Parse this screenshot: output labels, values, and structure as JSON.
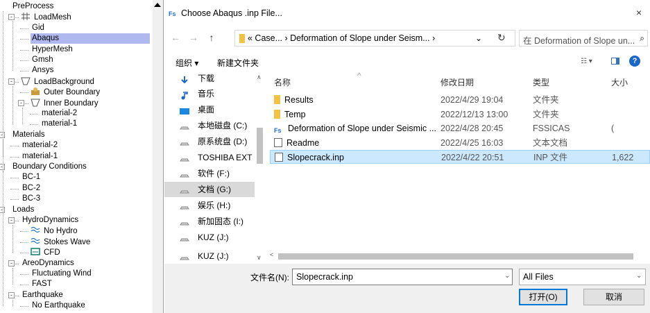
{
  "tree": {
    "nodes": [
      {
        "label": "PreProcess",
        "level": 0,
        "exp": "",
        "icon": ""
      },
      {
        "label": "LoadMesh",
        "level": 1,
        "exp": "-",
        "icon": "mesh"
      },
      {
        "label": "Gid",
        "level": 2,
        "exp": "",
        "icon": ""
      },
      {
        "label": "Abaqus",
        "level": 2,
        "exp": "",
        "icon": "",
        "selected": true
      },
      {
        "label": "HyperMesh",
        "level": 2,
        "exp": "",
        "icon": ""
      },
      {
        "label": "Gmsh",
        "level": 2,
        "exp": "",
        "icon": ""
      },
      {
        "label": "Ansys",
        "level": 2,
        "exp": "",
        "icon": ""
      },
      {
        "label": "LoadBackground",
        "level": 1,
        "exp": "-",
        "icon": "trapezoid"
      },
      {
        "label": "Outer Boundary",
        "level": 2,
        "exp": "",
        "icon": "outer"
      },
      {
        "label": "Inner Boundary",
        "level": 2,
        "exp": "-",
        "icon": "trapezoid"
      },
      {
        "label": "material-2",
        "level": 3,
        "exp": "",
        "icon": ""
      },
      {
        "label": "material-1",
        "level": 3,
        "exp": "",
        "icon": ""
      },
      {
        "label": "Materials",
        "level": 0,
        "exp": "-",
        "icon": ""
      },
      {
        "label": "material-2",
        "level": 1,
        "exp": "",
        "icon": ""
      },
      {
        "label": "material-1",
        "level": 1,
        "exp": "",
        "icon": ""
      },
      {
        "label": "Boundary Conditions",
        "level": 0,
        "exp": "-",
        "icon": ""
      },
      {
        "label": "BC-1",
        "level": 1,
        "exp": "",
        "icon": ""
      },
      {
        "label": "BC-2",
        "level": 1,
        "exp": "",
        "icon": ""
      },
      {
        "label": "BC-3",
        "level": 1,
        "exp": "",
        "icon": ""
      },
      {
        "label": "Loads",
        "level": 0,
        "exp": "-",
        "icon": ""
      },
      {
        "label": "HydroDynamics",
        "level": 1,
        "exp": "-",
        "icon": ""
      },
      {
        "label": "No Hydro",
        "level": 2,
        "exp": "",
        "icon": "wave"
      },
      {
        "label": "Stokes Wave",
        "level": 2,
        "exp": "",
        "icon": "wave"
      },
      {
        "label": "CFD",
        "level": 2,
        "exp": "",
        "icon": "cfd"
      },
      {
        "label": "AreoDynamics",
        "level": 1,
        "exp": "-",
        "icon": ""
      },
      {
        "label": "Fluctuating Wind",
        "level": 2,
        "exp": "",
        "icon": ""
      },
      {
        "label": "FAST",
        "level": 2,
        "exp": "",
        "icon": ""
      },
      {
        "label": "Earthquake",
        "level": 1,
        "exp": "-",
        "icon": ""
      },
      {
        "label": "No Earthquake",
        "level": 2,
        "exp": "",
        "icon": ""
      }
    ]
  },
  "dialog": {
    "title": "Choose Abaqus .inp File...",
    "close": "×",
    "address": "« Case...  ›  Deformation of Slope under Seism...  ›",
    "search_placeholder": "在 Deformation of Slope un...",
    "toolbar": {
      "organize": "组织 ▾",
      "new_folder": "新建文件夹"
    },
    "nav_items": [
      {
        "label": "下载",
        "icon": "download"
      },
      {
        "label": "音乐",
        "icon": "music"
      },
      {
        "label": "桌面",
        "icon": "desktop"
      },
      {
        "label": "本地磁盘 (C:)",
        "icon": "drive"
      },
      {
        "label": "原系统盘 (D:)",
        "icon": "drive"
      },
      {
        "label": "TOSHIBA EXT (I",
        "icon": "drive"
      },
      {
        "label": "软件 (F:)",
        "icon": "drive"
      },
      {
        "label": "文档 (G:)",
        "icon": "drive",
        "selected": true
      },
      {
        "label": "娱乐 (H:)",
        "icon": "drive"
      },
      {
        "label": "新加固态 (I:)",
        "icon": "drive"
      },
      {
        "label": "KUZ (J:)",
        "icon": "drive"
      },
      {
        "label": "KUZ (J:)",
        "icon": "drive"
      }
    ],
    "columns": {
      "name": "名称",
      "date": "修改日期",
      "type": "类型",
      "size": "大小"
    },
    "files": [
      {
        "name": "Results",
        "date": "2022/4/29 19:04",
        "type": "文件夹",
        "size": "",
        "icon": "folder"
      },
      {
        "name": "Temp",
        "date": "2022/12/13 13:00",
        "type": "文件夹",
        "size": "",
        "icon": "folder"
      },
      {
        "name": "Deformation of Slope under Seismic ...",
        "date": "2022/4/28 20:45",
        "type": "FSSICAS",
        "size": "(",
        "icon": "app"
      },
      {
        "name": "Readme",
        "date": "2022/4/25 16:03",
        "type": "文本文档",
        "size": "",
        "icon": "doc"
      },
      {
        "name": "Slopecrack.inp",
        "date": "2022/4/22 20:51",
        "type": "INP 文件",
        "size": "1,622",
        "icon": "doc",
        "selected": true
      }
    ],
    "filename_label": "文件名(N):",
    "filename_value": "Slopecrack.inp",
    "filter_value": "All Files",
    "open_label": "打开(O)",
    "cancel_label": "取消"
  }
}
